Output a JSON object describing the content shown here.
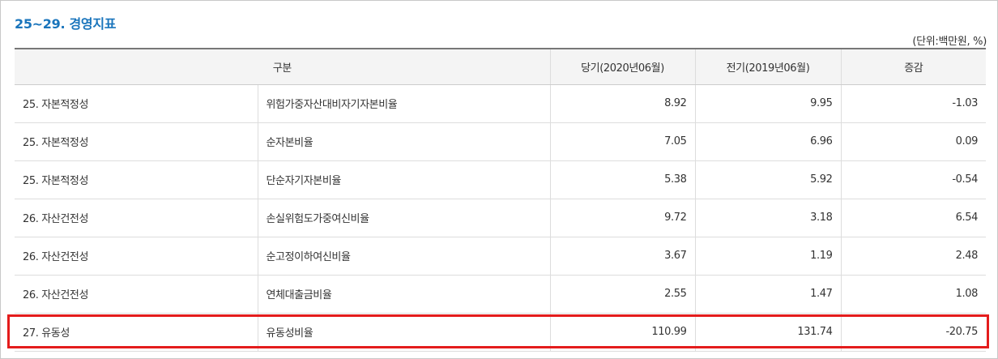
{
  "section": {
    "title": "25~29. 경영지표",
    "unit": "(단위:백만원, %)"
  },
  "table": {
    "headers": [
      "구분",
      "당기(2020년06월)",
      "전기(2019년06월)",
      "증감"
    ],
    "rows": [
      {
        "category": "25. 자본적정성",
        "item": "위험가중자산대비자기자본비율",
        "current": "8.92",
        "previous": "9.95",
        "change": "-1.03"
      },
      {
        "category": "25. 자본적정성",
        "item": "순자본비율",
        "current": "7.05",
        "previous": "6.96",
        "change": "0.09"
      },
      {
        "category": "25. 자본적정성",
        "item": "단순자기자본비율",
        "current": "5.38",
        "previous": "5.92",
        "change": "-0.54"
      },
      {
        "category": "26. 자산건전성",
        "item": "손실위험도가중여신비율",
        "current": "9.72",
        "previous": "3.18",
        "change": "6.54"
      },
      {
        "category": "26. 자산건전성",
        "item": "순고정이하여신비율",
        "current": "3.67",
        "previous": "1.19",
        "change": "2.48"
      },
      {
        "category": "26. 자산건전성",
        "item": "연체대출금비율",
        "current": "2.55",
        "previous": "1.47",
        "change": "1.08"
      },
      {
        "category": "27. 유동성",
        "item": "유동성비율",
        "current": "110.99",
        "previous": "131.74",
        "change": "-20.75"
      }
    ]
  },
  "colors": {
    "title": "#1a75bc",
    "highlight": "#e41c1c",
    "header_bg": "#f4f4f4"
  }
}
